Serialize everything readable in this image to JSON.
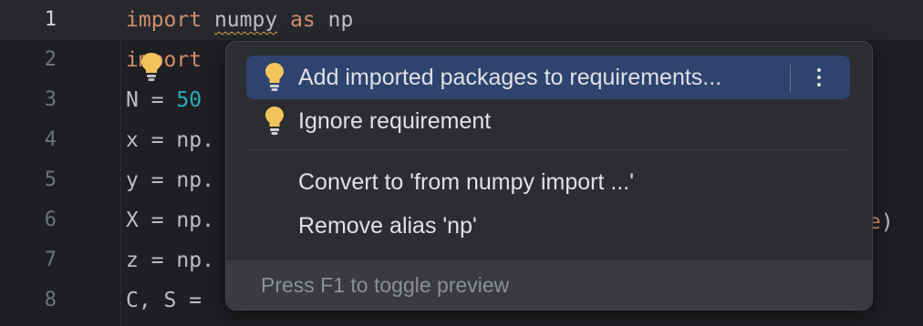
{
  "editor": {
    "lines": [
      {
        "num": "1",
        "parts": [
          {
            "t": "import",
            "c": "kw"
          },
          {
            "t": " "
          },
          {
            "t": "numpy",
            "c": "warn"
          },
          {
            "t": " "
          },
          {
            "t": "as",
            "c": "kw"
          },
          {
            "t": " np"
          }
        ]
      },
      {
        "num": "2",
        "parts": [
          {
            "t": "import",
            "c": "kw"
          }
        ]
      },
      {
        "num": "3",
        "parts": [
          {
            "t": "N = "
          },
          {
            "t": "50",
            "c": "num"
          }
        ]
      },
      {
        "num": "4",
        "parts": [
          {
            "t": "x = np."
          }
        ]
      },
      {
        "num": "5",
        "parts": [
          {
            "t": "y = np."
          }
        ]
      },
      {
        "num": "6",
        "parts": [
          {
            "t": "X = np."
          }
        ]
      },
      {
        "num": "7",
        "parts": [
          {
            "t": "z = np."
          }
        ]
      },
      {
        "num": "8",
        "parts": [
          {
            "t": "C, S = "
          }
        ]
      }
    ],
    "current_line": 1,
    "line6_tail": {
      "kw": "e",
      "plain": ")"
    },
    "inline_icon": "lightbulb-icon"
  },
  "popup": {
    "items": [
      {
        "label": "Add imported packages to requirements...",
        "icon": "lightbulb-icon",
        "selected": true,
        "has_more": true
      },
      {
        "label": "Ignore requirement",
        "icon": "lightbulb-icon",
        "selected": false,
        "has_more": false
      },
      {
        "label": "Convert to 'from numpy import ...'",
        "icon": "",
        "selected": false,
        "has_more": false
      },
      {
        "label": "Remove alias 'np'",
        "icon": "",
        "selected": false,
        "has_more": false
      }
    ],
    "footer": "Press F1 to toggle preview"
  },
  "colors": {
    "background": "#1e1f22",
    "keyword": "#cf8e6d",
    "number": "#2aacb8",
    "selection": "#2e436e",
    "bulb": "#f2c55c"
  }
}
